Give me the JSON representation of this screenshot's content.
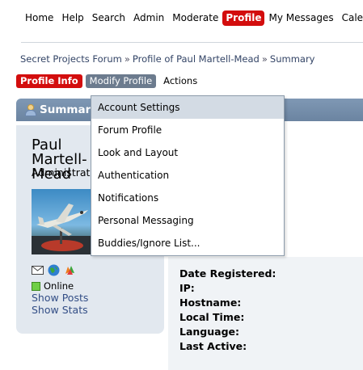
{
  "top_menu": {
    "items": [
      "Home",
      "Help",
      "Search",
      "Admin",
      "Moderate",
      "Profile",
      "My Messages",
      "Calendar"
    ]
  },
  "breadcrumb": {
    "items": [
      "Secret Projects Forum",
      "Profile of Paul Martell-Mead",
      "Summary"
    ],
    "separator": "»"
  },
  "profile_menu": {
    "profile_info": "Profile Info",
    "modify_profile": "Modify Profile",
    "actions": "Actions"
  },
  "dropdown": {
    "items": [
      "Account Settings",
      "Forum Profile",
      "Look and Layout",
      "Authentication",
      "Notifications",
      "Personal Messaging",
      "Buddies/Ignore List..."
    ]
  },
  "summary": {
    "title": "Summary"
  },
  "user": {
    "name": "Paul Martell-Mead",
    "position": "Administrator",
    "status": "Online",
    "show_posts": "Show Posts",
    "show_stats": "Show Stats"
  },
  "details": {
    "labels": [
      "Date Registered:",
      "IP:",
      "Hostname:",
      "Local Time:",
      "Language:",
      "Last Active:"
    ]
  },
  "icons": [
    "email-icon",
    "website-icon",
    "msn-icon"
  ],
  "colors": {
    "accent_red": "#d30d0d",
    "header_blue": "#7690ad",
    "panel_bg": "#e2e8ef",
    "link": "#334e86"
  }
}
